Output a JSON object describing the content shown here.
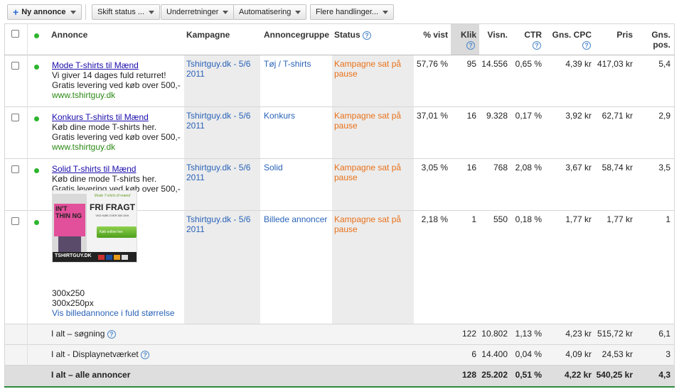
{
  "toolbar": {
    "new_ad": "Ny annonce",
    "change_status": "Skift status ...",
    "notifications": "Underretninger",
    "automation": "Automatisering",
    "more_actions": "Flere handlinger..."
  },
  "columns": {
    "ad": "Annonce",
    "campaign": "Kampagne",
    "adgroup": "Annoncegruppe",
    "status": "Status",
    "pct_shown": "% vist",
    "clicks": "Klik",
    "impressions": "Visn.",
    "ctr": "CTR",
    "avg_cpc": "Gns. CPC",
    "price": "Pris",
    "avg_pos": "Gns. pos.",
    "help": "?"
  },
  "rows": [
    {
      "title": "Mode T-shirts til Mænd",
      "line1": "Vi giver 14 dages fuld returret!",
      "line2": "Gratis levering ved køb over 500,-",
      "url": "www.tshirtguy.dk",
      "campaign": "Tshirtguy.dk - 5/6 2011",
      "adgroup": "Tøj / T-shirts",
      "status": "Kampagne sat på pause",
      "pct_shown": "57,76 %",
      "clicks": "95",
      "impressions": "14.556",
      "ctr": "0,65 %",
      "avg_cpc": "4,39 kr",
      "price": "417,03 kr",
      "avg_pos": "5,4"
    },
    {
      "title": "Konkurs T-shirts til Mænd",
      "line1": "Køb dine mode T-shirts her.",
      "line2": "Gratis levering ved køb over 500,-",
      "url": "www.tshirtguy.dk",
      "campaign": "Tshirtguy.dk - 5/6 2011",
      "adgroup": "Konkurs",
      "status": "Kampagne sat på pause",
      "pct_shown": "37,01 %",
      "clicks": "16",
      "impressions": "9.328",
      "ctr": "0,17 %",
      "avg_cpc": "3,92 kr",
      "price": "62,71 kr",
      "avg_pos": "2,9"
    },
    {
      "title": "Solid T-shirts til Mænd",
      "line1": "Køb dine mode T-shirts her.",
      "line2": "Gratis levering ved køb over 500,-",
      "url": "www.tshirtguy.dk",
      "campaign": "Tshirtguy.dk - 5/6 2011",
      "adgroup": "Solid",
      "status": "Kampagne sat på pause",
      "pct_shown": "3,05 %",
      "clicks": "16",
      "impressions": "768",
      "ctr": "2,08 %",
      "avg_cpc": "3,67 kr",
      "price": "58,74 kr",
      "avg_pos": "3,5"
    },
    {
      "size1": "300x250",
      "size2": "300x250px",
      "view_link": "Vis billedannonce i fuld størrelse",
      "campaign": "Tshirtguy.dk - 5/6 2011",
      "adgroup": "Billede annoncer",
      "status": "Kampagne sat på pause",
      "pct_shown": "2,18 %",
      "clicks": "1",
      "impressions": "550",
      "ctr": "0,18 %",
      "avg_cpc": "1,77 kr",
      "price": "1,77 kr",
      "avg_pos": "1"
    }
  ],
  "banner": {
    "tagline": "Mode T-shirts til mænd",
    "headline": "FRI FRAGT",
    "sub": "VED KØB OVER 500 DKK",
    "button": "Køb online her",
    "logo": "TSHIRTGUY.DK",
    "shirt_text": "IN'T THIN NG"
  },
  "totals": [
    {
      "label": "I alt – søgning",
      "clicks": "122",
      "impressions": "10.802",
      "ctr": "1,13 %",
      "avg_cpc": "4,23 kr",
      "price": "515,72 kr",
      "avg_pos": "6,1"
    },
    {
      "label": "I alt - Displaynetværket",
      "clicks": "6",
      "impressions": "14.400",
      "ctr": "0,04 %",
      "avg_cpc": "4,09 kr",
      "price": "24,53 kr",
      "avg_pos": "3"
    },
    {
      "label": "I alt – alle annoncer",
      "clicks": "128",
      "impressions": "25.202",
      "ctr": "0,51 %",
      "avg_cpc": "4,22 kr",
      "price": "540,25 kr",
      "avg_pos": "4,3"
    }
  ]
}
